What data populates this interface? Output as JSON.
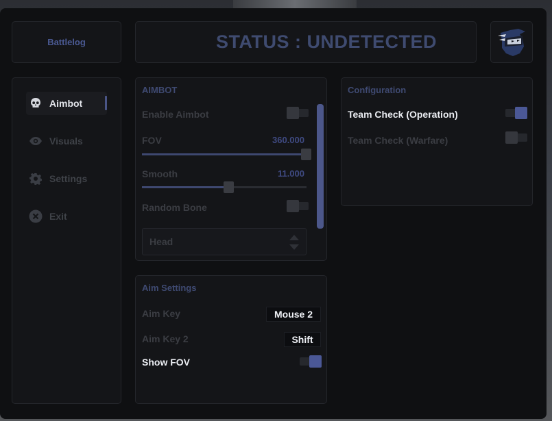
{
  "header": {
    "brand": "Battlelog",
    "status": "STATUS : UNDETECTED",
    "avatar_icon": "ninja-avatar-icon"
  },
  "sidebar": {
    "items": [
      {
        "label": "Aimbot",
        "icon": "skull-icon",
        "active": true
      },
      {
        "label": "Visuals",
        "icon": "eye-icon",
        "active": false
      },
      {
        "label": "Settings",
        "icon": "gear-icon",
        "active": false
      },
      {
        "label": "Exit",
        "icon": "close-circle-icon",
        "active": false
      }
    ]
  },
  "aimbot": {
    "title": "AIMBOT",
    "enable_label": "Enable Aimbot",
    "enable_on": false,
    "fov_label": "FOV",
    "fov_value": "360.000",
    "fov_fraction": 1.0,
    "smooth_label": "Smooth",
    "smooth_value": "11.000",
    "smooth_fraction": 0.53,
    "random_bone_label": "Random Bone",
    "random_bone_on": false,
    "bone_select": "Head"
  },
  "aim_settings": {
    "title": "Aim Settings",
    "aim_key_label": "Aim Key",
    "aim_key_value": "Mouse 2",
    "aim_key2_label": "Aim Key 2",
    "aim_key2_value": "Shift",
    "show_fov_label": "Show FOV",
    "show_fov_on": true
  },
  "configuration": {
    "title": "Configuration",
    "team_check_op_label": "Team Check (Operation)",
    "team_check_op_on": true,
    "team_check_war_label": "Team Check (Warfare)",
    "team_check_war_on": false
  },
  "colors": {
    "accent": "#4b5896",
    "background": "#0f1012",
    "panel": "#141518"
  }
}
